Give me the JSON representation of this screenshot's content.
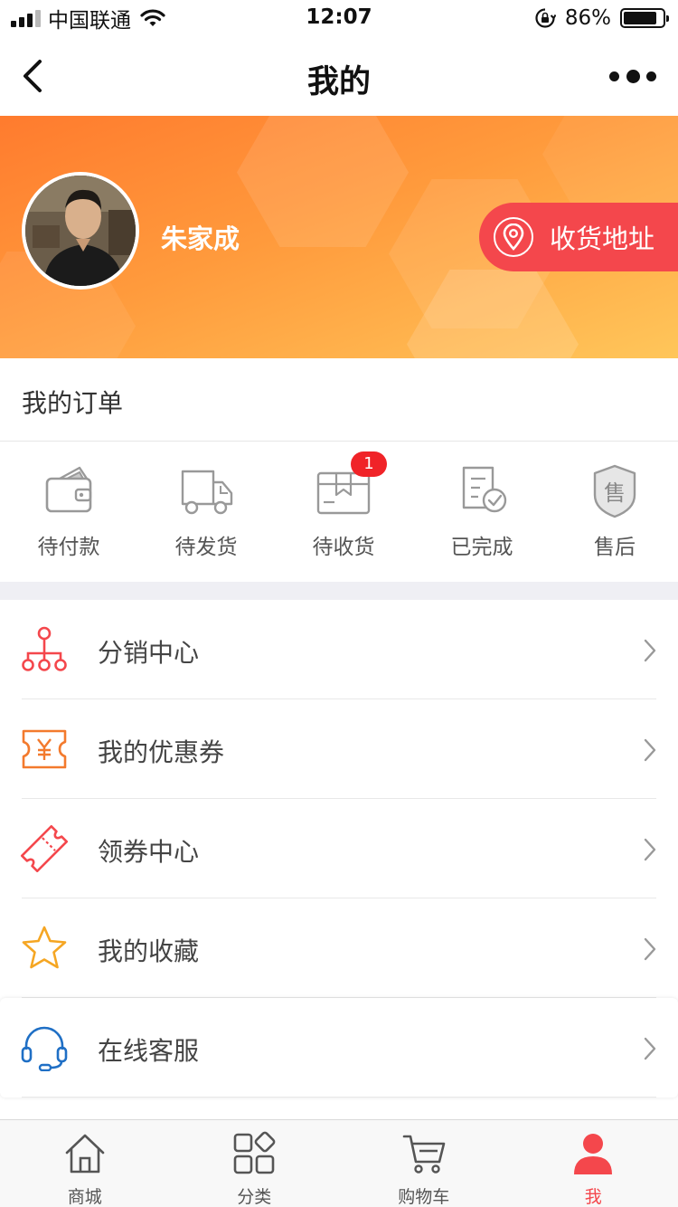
{
  "status_bar": {
    "carrier": "中国联通",
    "time": "12:07",
    "battery_percent": "86%",
    "battery_level": 0.86
  },
  "nav": {
    "title": "我的",
    "back_icon": "chevron-left-icon",
    "more_icon": "more-dots-icon"
  },
  "profile": {
    "name": "朱家成",
    "address_button": "收货地址",
    "banner_colors": [
      "#ff7b2e",
      "#ffc65a"
    ],
    "address_button_color": "#f4474c"
  },
  "orders": {
    "title": "我的订单",
    "items": [
      {
        "label": "待付款",
        "icon": "wallet-icon"
      },
      {
        "label": "待发货",
        "icon": "truck-icon"
      },
      {
        "label": "待收货",
        "icon": "package-icon",
        "badge": "1"
      },
      {
        "label": "已完成",
        "icon": "document-check-icon"
      },
      {
        "label": "售后",
        "icon": "shield-service-icon"
      }
    ]
  },
  "menu": [
    {
      "label": "分销中心",
      "icon": "distribution-tree-icon",
      "color": "#f4474c"
    },
    {
      "label": "我的优惠券",
      "icon": "yen-coupon-icon",
      "color": "#f37a2d"
    },
    {
      "label": "领券中心",
      "icon": "ticket-icon",
      "color": "#f4474c"
    },
    {
      "label": "我的收藏",
      "icon": "star-icon",
      "color": "#f5a623"
    },
    {
      "label": "在线客服",
      "icon": "headset-icon",
      "color": "#1f6fc5"
    }
  ],
  "tab_bar": {
    "items": [
      {
        "label": "商城",
        "icon": "home-icon",
        "active": false
      },
      {
        "label": "分类",
        "icon": "category-icon",
        "active": false
      },
      {
        "label": "购物车",
        "icon": "cart-icon",
        "active": false
      },
      {
        "label": "我",
        "icon": "user-icon",
        "active": true
      }
    ],
    "active_color": "#f4474c"
  }
}
